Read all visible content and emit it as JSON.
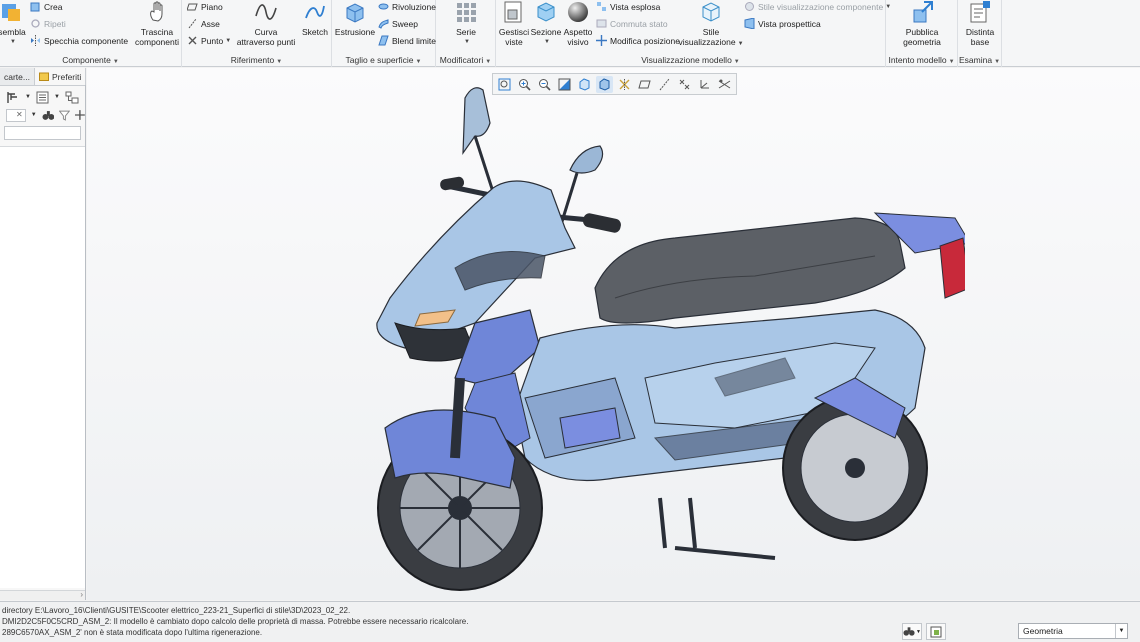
{
  "ribbon": {
    "groups": {
      "componente": "Componente",
      "riferimento": "Riferimento",
      "taglio": "Taglio e superficie",
      "modificatori": "Modificatori",
      "visualizzazione": "Visualizzazione modello",
      "intento": "Intento modello",
      "esamina": "Esamina"
    },
    "componente": {
      "assembla": "sembla",
      "crea": "Crea",
      "ripeti": "Ripeti",
      "specchia": "Specchia componente",
      "trascina_1": "Trascina",
      "trascina_2": "componenti"
    },
    "riferimento": {
      "piano": "Piano",
      "asse": "Asse",
      "punto": "Punto",
      "curva_1": "Curva",
      "curva_2": "attraverso punti"
    },
    "taglio": {
      "sketch": "Sketch",
      "estrusione": "Estrusione",
      "rivoluzione": "Rivoluzione",
      "sweep": "Sweep",
      "blend": "Blend limite"
    },
    "modificatori": {
      "serie": "Serie"
    },
    "visualizzazione": {
      "gestisci_1": "Gestisci",
      "gestisci_2": "viste",
      "sezione": "Sezione",
      "aspetto_1": "Aspetto",
      "aspetto_2": "visivo",
      "vista_esplosa": "Vista esplosa",
      "commuta_stato": "Commuta stato",
      "modifica_posizione": "Modifica posizione",
      "stile_1": "Stile",
      "stile_2": "visualizzazione",
      "stile_componente": "Stile visualizzazione componente",
      "vista_prospettica": "Vista prospettica"
    },
    "intento": {
      "pubblica_1": "Pubblica",
      "pubblica_2": "geometria"
    },
    "esamina": {
      "distinta_1": "Distinta",
      "distinta_2": "base"
    }
  },
  "left_panel": {
    "tabs": [
      "carte...",
      "Preferiti"
    ]
  },
  "status": {
    "messages": [
      "directory E:\\Lavoro_16\\Clienti\\GUSITE\\Scooter elettrico_223-21_Superfici di stile\\3D\\2023_02_22.",
      "DMI2D2C5F0C5CRD_ASM_2: Il modello è cambiato dopo calcolo delle proprietà di massa. Potrebbe essere necessario ricalcolare.",
      "289C6570AX_ASM_2' non è stata modificata dopo l'ultima rigenerazione."
    ],
    "filter_value": "Geometria"
  },
  "colors": {
    "ribbon_bg": "#f5f6f7",
    "model_body": "#a9c6e6",
    "model_accent": "#6f86d8",
    "seat": "#5c6066",
    "tire": "#3a3d42"
  }
}
